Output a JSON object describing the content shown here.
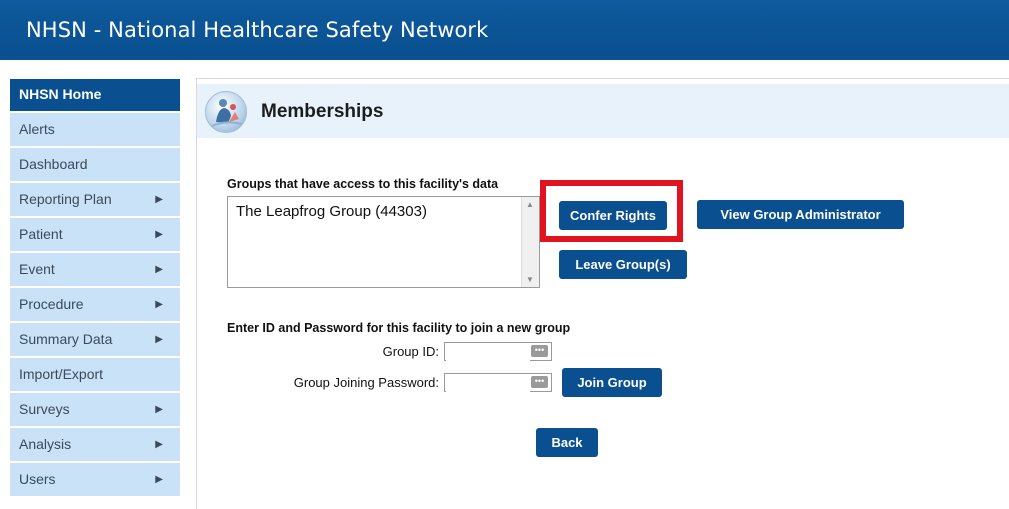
{
  "app": {
    "title": "NHSN - National Healthcare Safety Network"
  },
  "sidebar": {
    "items": [
      {
        "label": "NHSN Home",
        "has_submenu": false
      },
      {
        "label": "Alerts",
        "has_submenu": false
      },
      {
        "label": "Dashboard",
        "has_submenu": false
      },
      {
        "label": "Reporting Plan",
        "has_submenu": true
      },
      {
        "label": "Patient",
        "has_submenu": true
      },
      {
        "label": "Event",
        "has_submenu": true
      },
      {
        "label": "Procedure",
        "has_submenu": true
      },
      {
        "label": "Summary Data",
        "has_submenu": true
      },
      {
        "label": "Import/Export",
        "has_submenu": false
      },
      {
        "label": "Surveys",
        "has_submenu": true
      },
      {
        "label": "Analysis",
        "has_submenu": true
      },
      {
        "label": "Users",
        "has_submenu": true
      }
    ],
    "arrow_glyph": "▶"
  },
  "page": {
    "title": "Memberships",
    "icon": "memberships-icon"
  },
  "groups": {
    "label": "Groups that have access to this facility's data",
    "list": [
      "The Leapfrog Group (44303)"
    ],
    "confer_rights_label": "Confer Rights",
    "view_admin_label": "View Group Administrator",
    "leave_label": "Leave Group(s)"
  },
  "join": {
    "label": "Enter ID and Password for this facility to join a new group",
    "group_id_label": "Group ID:",
    "group_id_value": "",
    "password_label": "Group Joining Password:",
    "password_value": "",
    "join_label": "Join Group"
  },
  "back_label": "Back",
  "colors": {
    "brand": "#0a4f8f",
    "nav_bg": "#c9e2f7",
    "highlight": "#e0141e",
    "header_band": "#e8f2fb"
  }
}
